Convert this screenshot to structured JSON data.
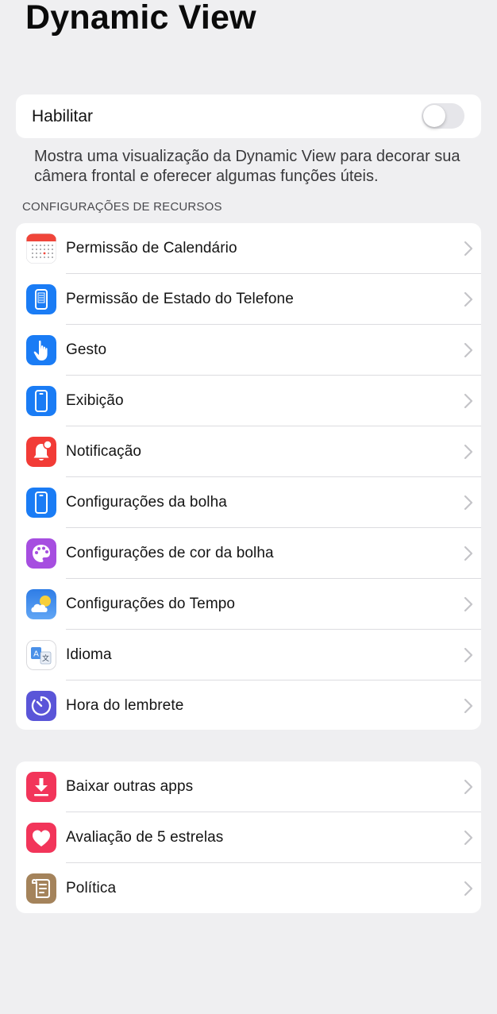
{
  "page": {
    "title": "Dynamic View"
  },
  "enable": {
    "label": "Habilitar",
    "enabled": false
  },
  "description": "Mostra uma visualização da Dynamic View para decorar sua câmera frontal e oferecer algumas funções úteis.",
  "features": {
    "header": "CONFIGURAÇÕES DE RECURSOS",
    "items": [
      {
        "label": "Permissão de Calendário",
        "icon": "calendar-icon",
        "color": "#ffffff"
      },
      {
        "label": "Permissão de Estado do Telefone",
        "icon": "phone-state-icon",
        "color": "#1a7cf5"
      },
      {
        "label": "Gesto",
        "icon": "hand-gesture-icon",
        "color": "#1a7cf5"
      },
      {
        "label": "Exibição",
        "icon": "phone-display-icon",
        "color": "#1a7cf5"
      },
      {
        "label": "Notificação",
        "icon": "bell-icon",
        "color": "#f23b36"
      },
      {
        "label": "Configurações da bolha",
        "icon": "phone-bubble-icon",
        "color": "#1a7cf5"
      },
      {
        "label": "Configurações de cor da bolha",
        "icon": "palette-icon",
        "color": "#a64ee0"
      },
      {
        "label": "Configurações do Tempo",
        "icon": "weather-icon",
        "color": "#1f77e0"
      },
      {
        "label": "Idioma",
        "icon": "translate-icon",
        "color": "#ffffff"
      },
      {
        "label": "Hora do lembrete",
        "icon": "timer-icon",
        "color": "#5a55d8"
      }
    ]
  },
  "extras": {
    "items": [
      {
        "label": "Baixar outras apps",
        "icon": "download-icon",
        "color": "#f2355a"
      },
      {
        "label": "Avaliação de 5 estrelas",
        "icon": "heart-icon",
        "color": "#f2355a"
      },
      {
        "label": "Política",
        "icon": "document-icon",
        "color": "#a4835b"
      }
    ]
  }
}
